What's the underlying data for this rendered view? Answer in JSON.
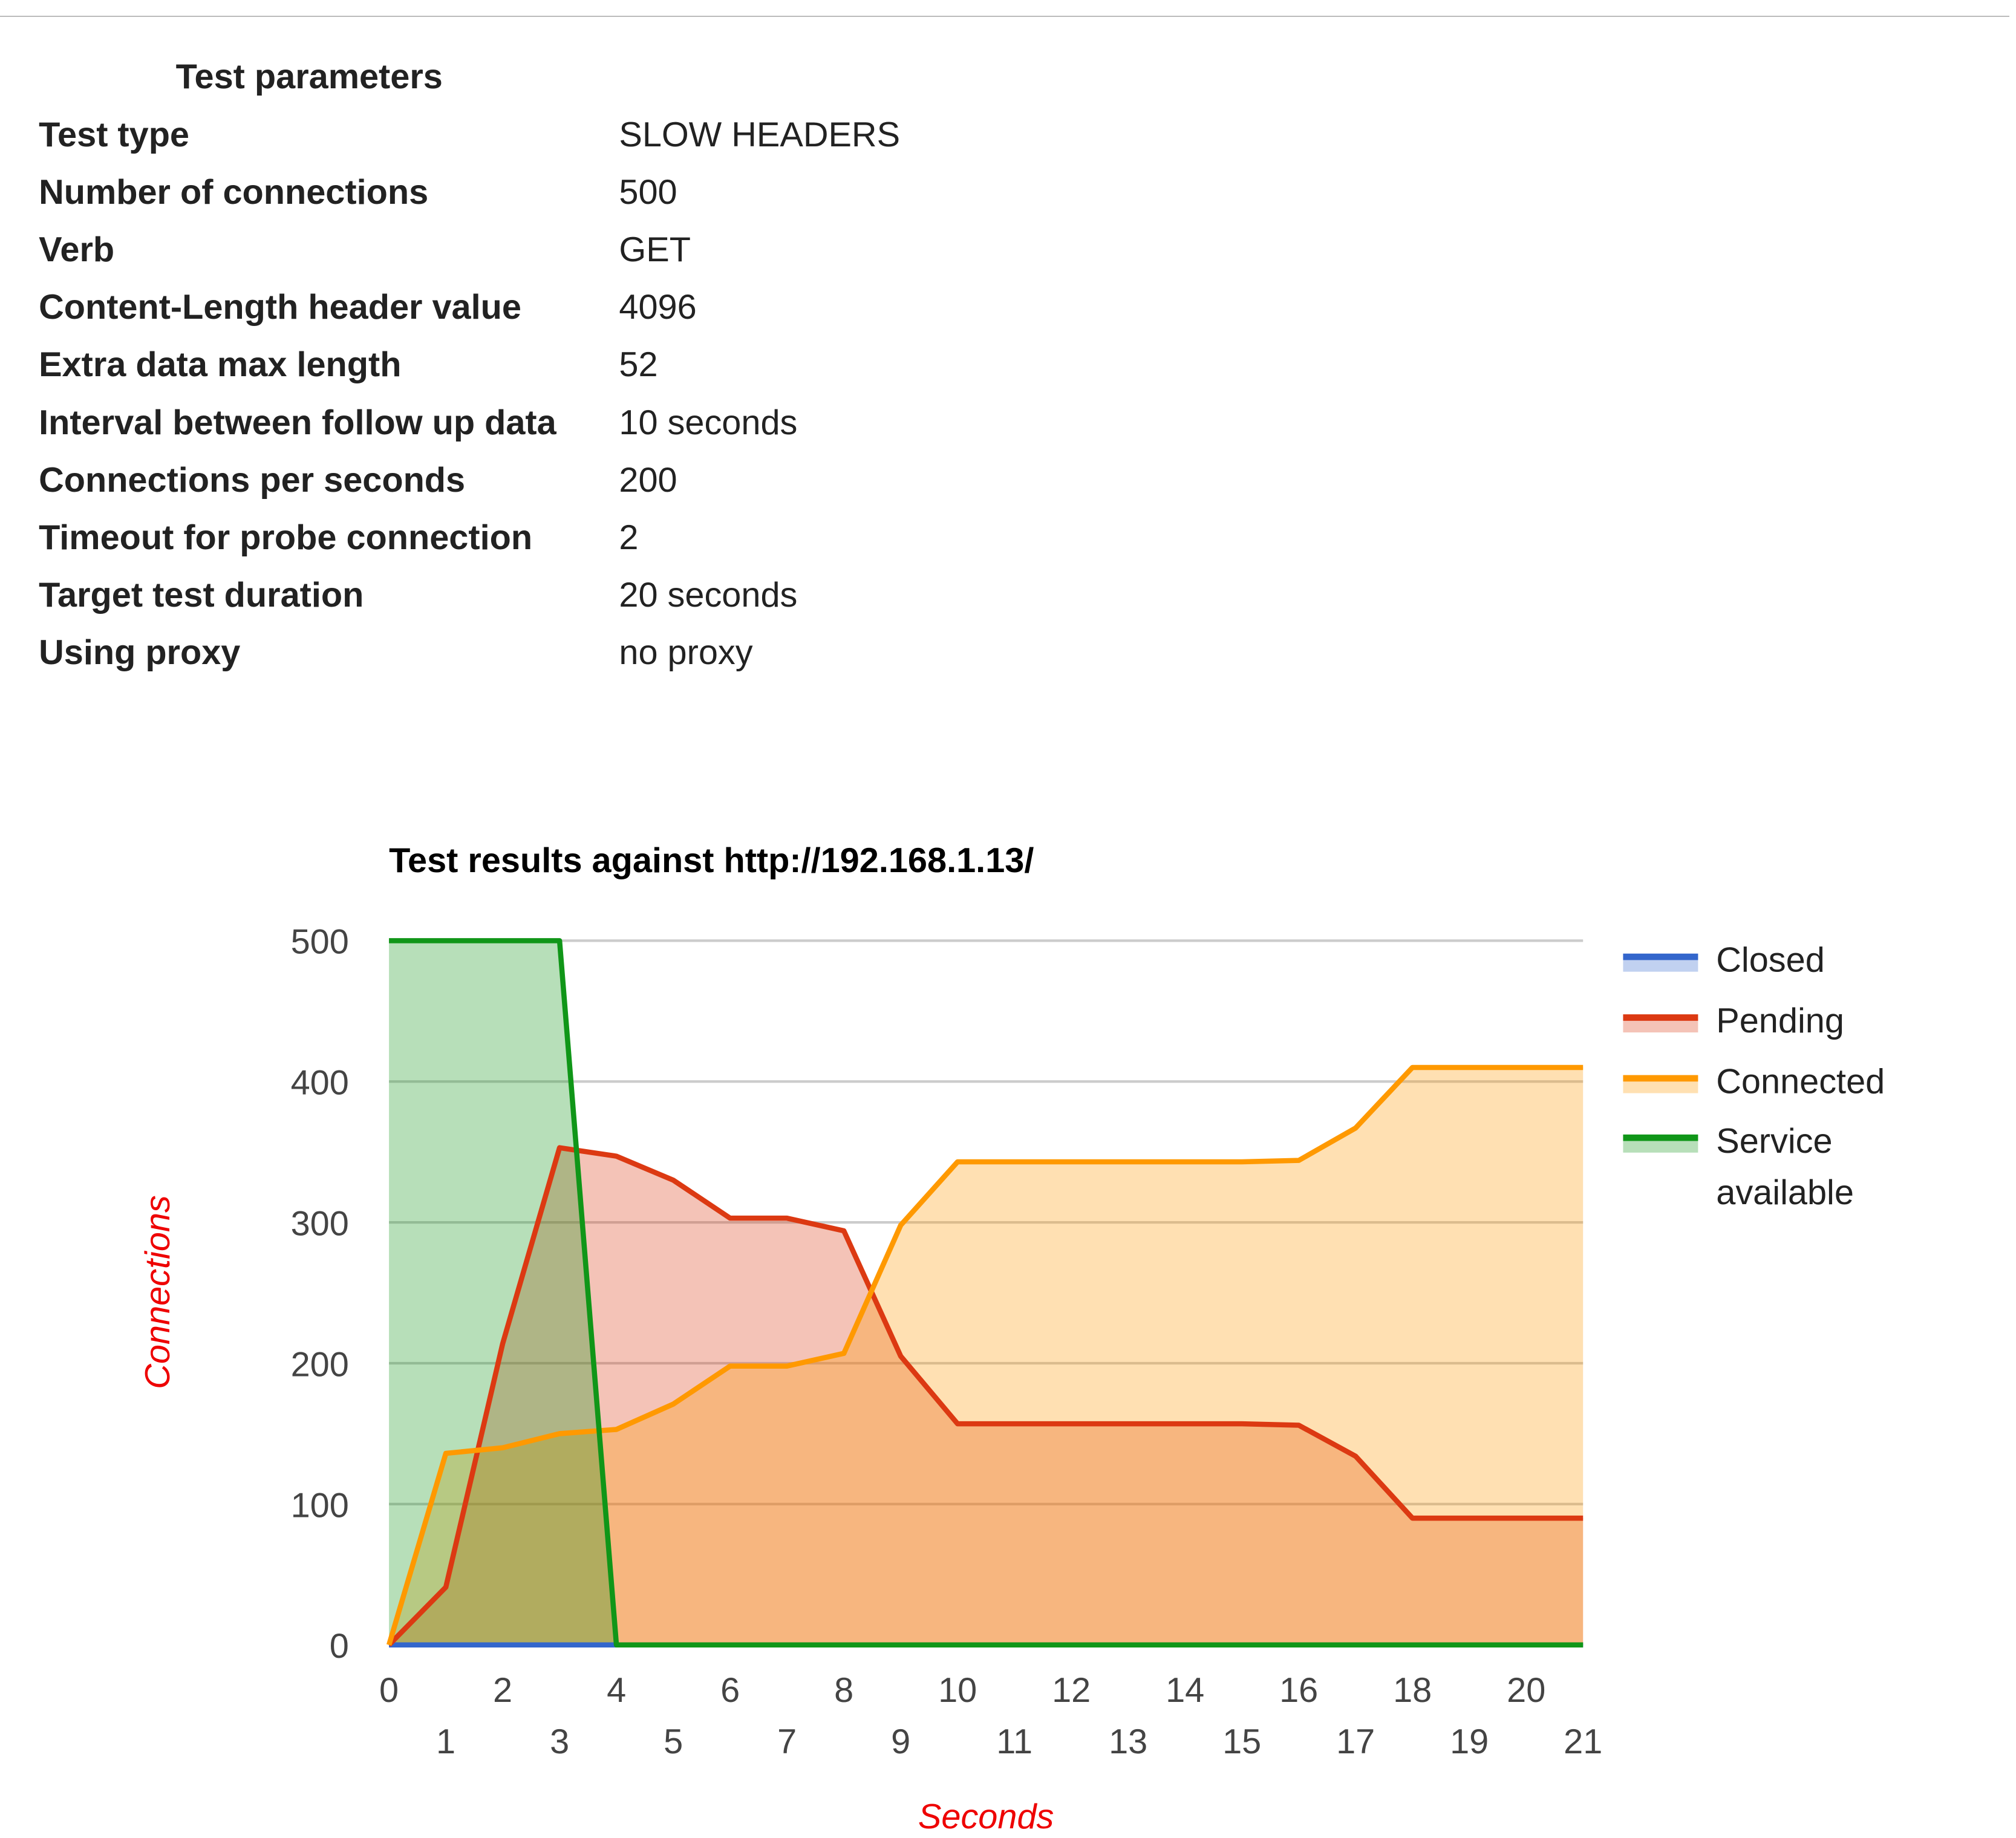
{
  "params": {
    "title": "Test parameters",
    "rows": [
      {
        "label": "Test type",
        "value": "SLOW HEADERS"
      },
      {
        "label": "Number of connections",
        "value": "500"
      },
      {
        "label": "Verb",
        "value": "GET"
      },
      {
        "label": "Content-Length header value",
        "value": "4096"
      },
      {
        "label": "Extra data max length",
        "value": "52"
      },
      {
        "label": "Interval between follow up data",
        "value": "10 seconds"
      },
      {
        "label": "Connections per seconds",
        "value": "200"
      },
      {
        "label": "Timeout for probe connection",
        "value": "2"
      },
      {
        "label": "Target test duration",
        "value": "20 seconds"
      },
      {
        "label": "Using proxy",
        "value": "no proxy"
      }
    ]
  },
  "chart_data": {
    "type": "area",
    "title": "Test results against http://192.168.1.13/",
    "xlabel": "Seconds",
    "ylabel": "Connections",
    "xlim": [
      0,
      21
    ],
    "ylim": [
      0,
      500
    ],
    "yticks": [
      0,
      100,
      200,
      300,
      400,
      500
    ],
    "xticks": [
      0,
      1,
      2,
      3,
      4,
      5,
      6,
      7,
      8,
      9,
      10,
      11,
      12,
      13,
      14,
      15,
      16,
      17,
      18,
      19,
      20,
      21
    ],
    "grid": true,
    "legend_position": "right",
    "x": [
      0,
      1,
      2,
      3,
      4,
      5,
      6,
      7,
      8,
      9,
      10,
      11,
      12,
      13,
      14,
      15,
      16,
      17,
      18,
      19,
      20,
      21
    ],
    "series": [
      {
        "name": "Closed",
        "color": "#3366cc",
        "values": [
          0,
          0,
          0,
          0,
          0,
          0,
          0,
          0,
          0,
          0,
          0,
          0,
          0,
          0,
          0,
          0,
          0,
          0,
          0,
          0,
          0,
          0
        ]
      },
      {
        "name": "Pending",
        "color": "#dc3912",
        "values": [
          0,
          41,
          214,
          353,
          347,
          330,
          303,
          303,
          294,
          205,
          157,
          157,
          157,
          157,
          157,
          157,
          156,
          134,
          90,
          90,
          90,
          90
        ]
      },
      {
        "name": "Connected",
        "color": "#ff9900",
        "values": [
          0,
          136,
          140,
          150,
          153,
          171,
          198,
          198,
          207,
          298,
          343,
          343,
          343,
          343,
          343,
          343,
          344,
          367,
          410,
          410,
          410,
          410
        ]
      },
      {
        "name": "Service available",
        "color": "#109618",
        "values": [
          500,
          500,
          500,
          500,
          0,
          0,
          0,
          0,
          0,
          0,
          0,
          0,
          0,
          0,
          0,
          0,
          0,
          0,
          0,
          0,
          0,
          0
        ]
      }
    ],
    "legend_lines": {
      "Service available": [
        "Service",
        "available"
      ]
    }
  }
}
